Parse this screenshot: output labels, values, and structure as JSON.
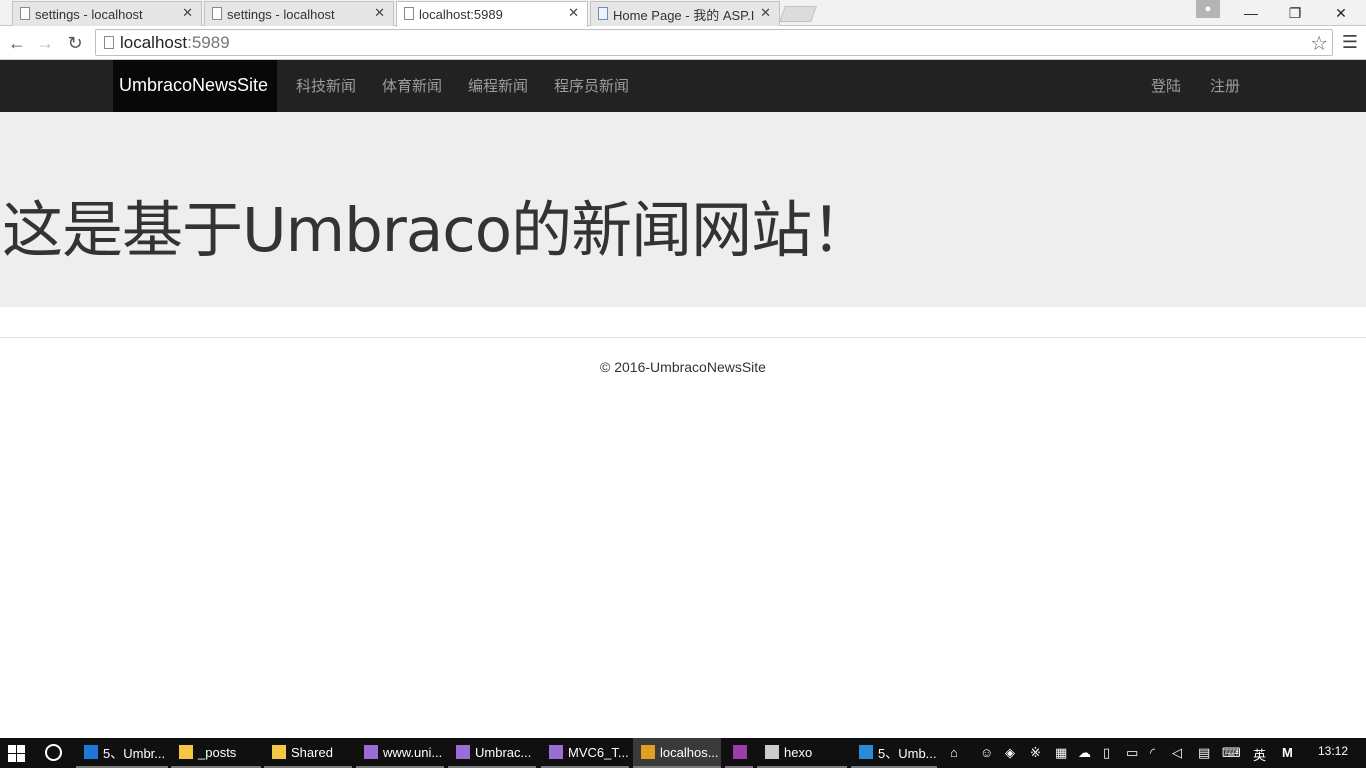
{
  "browser": {
    "tabs": [
      {
        "label": "settings - localhost",
        "active": false
      },
      {
        "label": "settings - localhost",
        "active": false
      },
      {
        "label": "localhost:5989",
        "active": true
      },
      {
        "label": "Home Page - 我的 ASP.I",
        "active": false
      }
    ],
    "url_host": "localhost",
    "url_port": ":5989",
    "window_controls": {
      "minimize": "—",
      "restore": "❐",
      "close": "✕"
    }
  },
  "site": {
    "brand": "UmbracoNewsSite",
    "nav_left": [
      "科技新闻",
      "体育新闻",
      "编程新闻",
      "程序员新闻"
    ],
    "nav_right": [
      "登陆",
      "注册"
    ],
    "hero_title": "这是基于Umbraco的新闻网站！",
    "footer": "© 2016-UmbracoNewsSite"
  },
  "taskbar": {
    "items": [
      {
        "label": "5、Umbr...",
        "icon": "edge-icon",
        "color": "#1e78d7"
      },
      {
        "label": "_posts",
        "icon": "folder-icon",
        "color": "#f5c842"
      },
      {
        "label": "Shared",
        "icon": "folder-icon",
        "color": "#f5c842"
      },
      {
        "label": "www.uni...",
        "icon": "visual-studio-icon",
        "color": "#9b6bd6"
      },
      {
        "label": "Umbrac...",
        "icon": "visual-studio-icon",
        "color": "#9b6bd6"
      },
      {
        "label": "MVC6_T...",
        "icon": "visual-studio-icon",
        "color": "#9b6bd6"
      },
      {
        "label": "localhos...",
        "icon": "chrome-icon",
        "color": "#e0a020"
      },
      {
        "label": "",
        "icon": "onenote-icon",
        "color": "#9b3fa8"
      },
      {
        "label": "hexo",
        "icon": "cmd-icon",
        "color": "#cccccc"
      },
      {
        "label": "5、Umb...",
        "icon": "vscode-icon",
        "color": "#2a8ad4"
      }
    ],
    "ime": "英",
    "clock": "13:12"
  }
}
